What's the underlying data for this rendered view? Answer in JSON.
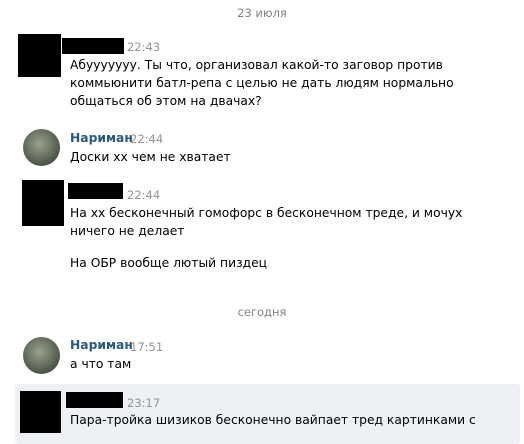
{
  "date_separators": [
    "23 июля",
    "сегодня"
  ],
  "messages": [
    {
      "author": "",
      "time": "22:43",
      "text": "Абууууууу. Ты что, организовал какой-то заговор против\nкоммьюнити батл-репа с целью не дать людям нормально\nобщаться об этом на двачах?"
    },
    {
      "author": "Нариман",
      "time": "22:44",
      "text": "Доски хх чем не хватает"
    },
    {
      "author": "",
      "time": "22:44",
      "text": "На хх бесконечный гомофорс в бесконечном треде, и мочух\nничего не делает",
      "text2": "На ОБР вообще лютый пиздец"
    },
    {
      "author": "Нариман",
      "time": "17:51",
      "text": "а что там"
    },
    {
      "author": "",
      "time": "23:17",
      "text": "Пара-тройка шизиков бесконечно вайпает тред картинками с"
    }
  ]
}
